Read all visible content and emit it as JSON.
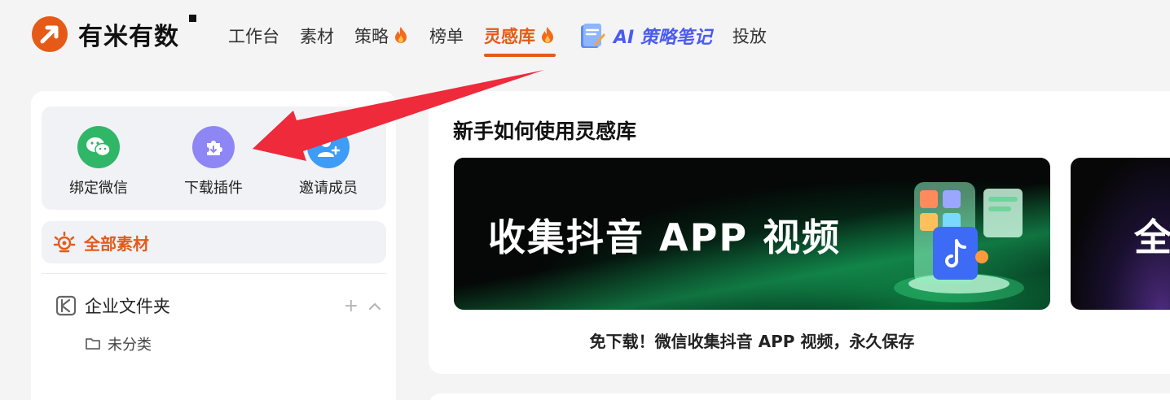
{
  "header": {
    "logo_text": "有米有数",
    "nav": [
      {
        "label": "工作台",
        "fire": false,
        "active": false
      },
      {
        "label": "素材",
        "fire": false,
        "active": false
      },
      {
        "label": "策略",
        "fire": true,
        "active": false
      },
      {
        "label": "榜单",
        "fire": false,
        "active": false
      },
      {
        "label": "灵感库",
        "fire": true,
        "active": true
      }
    ],
    "ai_note_label": "AI 策略笔记",
    "nav_last": "投放"
  },
  "sidebar": {
    "quick_actions": [
      {
        "label": "绑定微信",
        "icon": "wechat-icon",
        "color": "#2fb667"
      },
      {
        "label": "下载插件",
        "icon": "puzzle-icon",
        "color": "#8e86f4"
      },
      {
        "label": "邀请成员",
        "icon": "add-user-icon",
        "color": "#3d9cf6"
      }
    ],
    "all_materials_label": "全部素材",
    "folder_label": "企业文件夹",
    "folder_add": "+",
    "folder_collapse": "^",
    "subfolder_label": "未分类"
  },
  "main": {
    "title": "新手如何使用灵感库",
    "banner_text": "收集抖音 APP 视频",
    "banner2_text": "全",
    "banner_caption": "免下载！微信收集抖音 APP 视频，永久保存"
  },
  "colors": {
    "accent": "#e55a17",
    "annotation_arrow": "#ee2a3b",
    "ai_note": "#4a5bf0"
  }
}
